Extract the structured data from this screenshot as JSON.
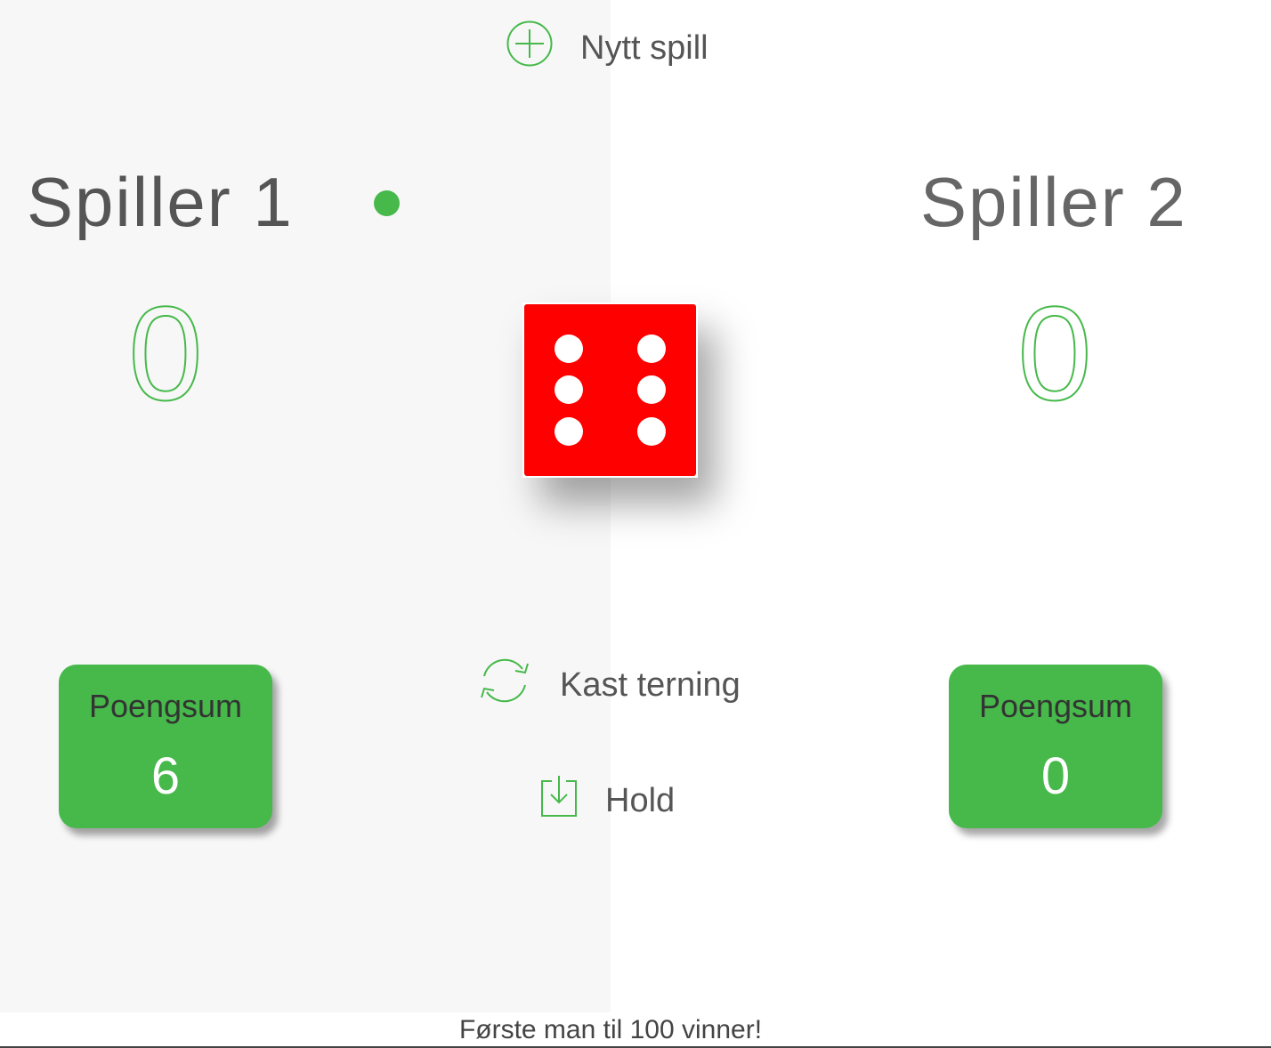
{
  "controls": {
    "new_game_label": "Nytt spill",
    "roll_label": "Kast terning",
    "hold_label": "Hold"
  },
  "players": [
    {
      "name": "Spiller 1",
      "current_score": "0",
      "total_label": "Poengsum",
      "total_score": "6",
      "active": true
    },
    {
      "name": "Spiller 2",
      "current_score": "0",
      "total_label": "Poengsum",
      "total_score": "0",
      "active": false
    }
  ],
  "dice": {
    "value": 6,
    "color": "#ff0000"
  },
  "colors": {
    "accent": "#46b94a",
    "left_panel": "#f7f7f7",
    "right_panel": "#ffffff"
  },
  "icons": {
    "new_game": "plus-circle-icon",
    "roll": "refresh-icon",
    "hold": "download-icon"
  },
  "footer": {
    "text": "Første man til 100 vinner!"
  }
}
